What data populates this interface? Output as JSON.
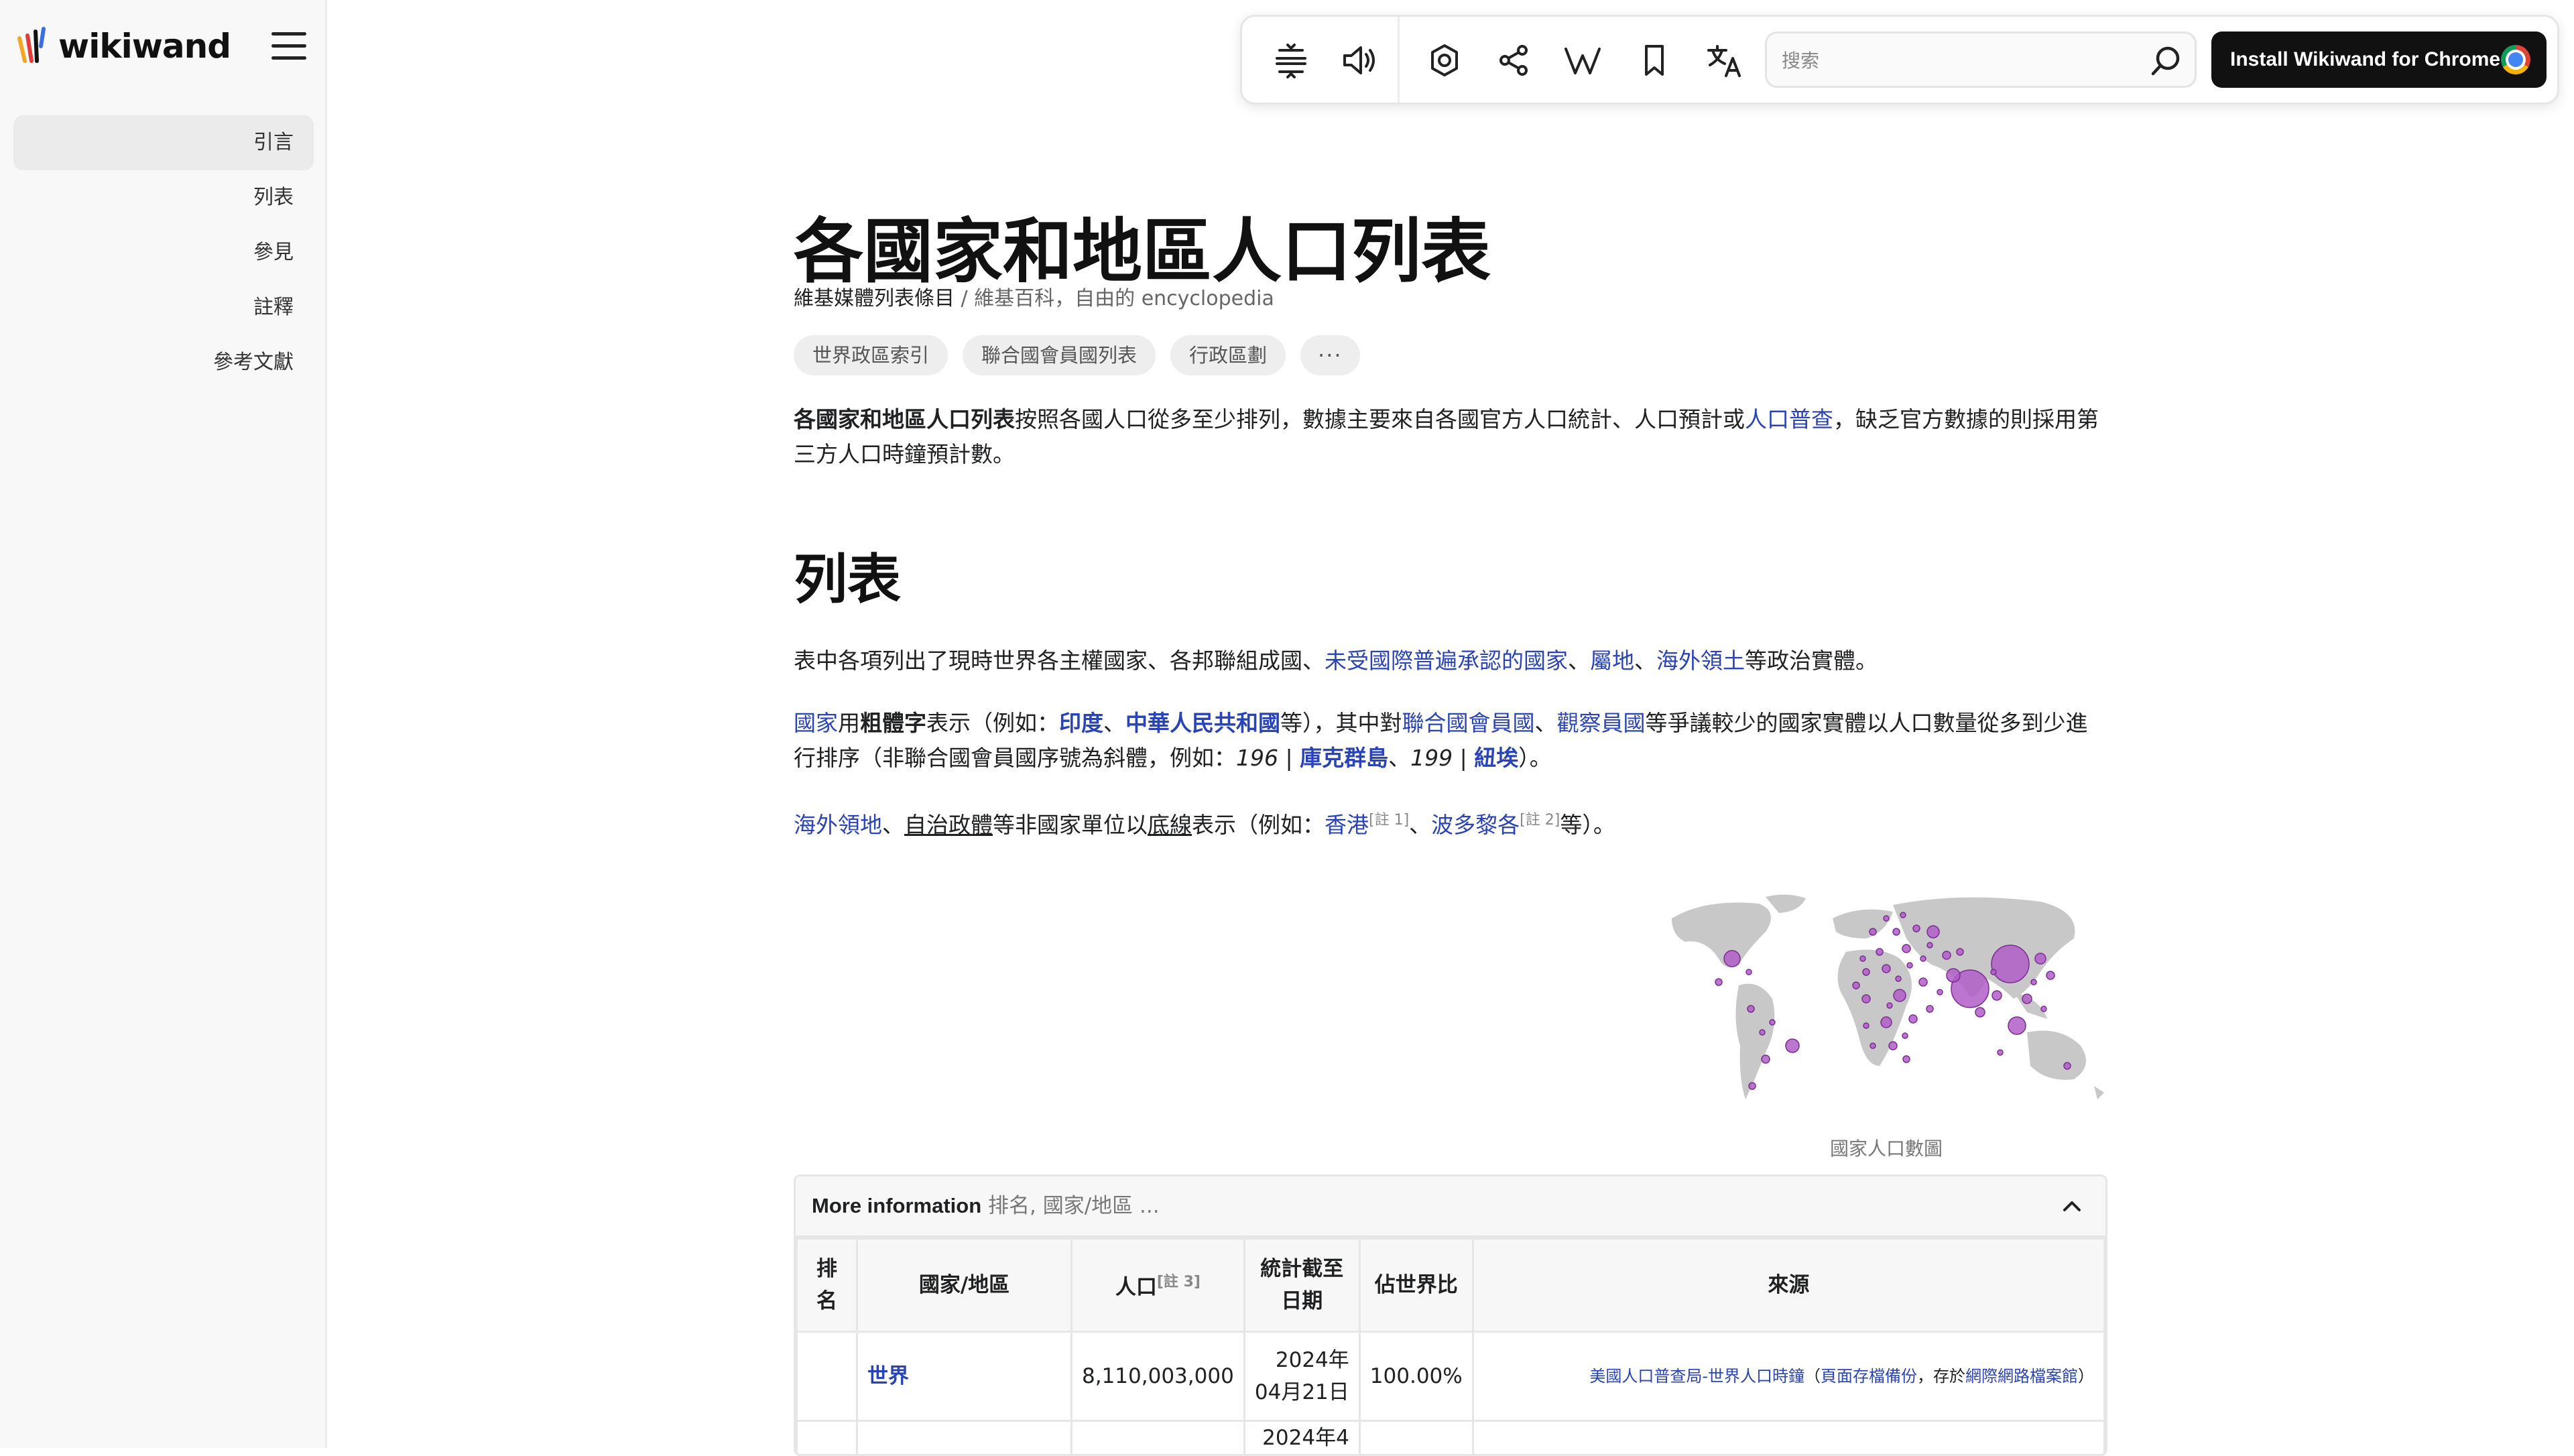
{
  "app": {
    "logo_text": "wikiwand"
  },
  "toc": {
    "items": [
      {
        "label": "引言"
      },
      {
        "label": "列表"
      },
      {
        "label": "參見"
      },
      {
        "label": "註釋"
      },
      {
        "label": "參考文獻"
      }
    ]
  },
  "toolbar": {
    "icons": [
      "text-density-icon",
      "speaker-icon",
      "settings-icon",
      "share-icon",
      "wikipedia-icon",
      "bookmark-icon",
      "translate-icon"
    ],
    "search_placeholder": "搜索",
    "install_label": "Install Wikiwand for Chrome"
  },
  "article": {
    "title": "各國家和地區人口列表",
    "subtitle_bold": "維基媒體列表條目",
    "subtitle_rest": " / 維基百科，自由的 encyclopedia",
    "chips": [
      "世界政區索引",
      "聯合國會員國列表",
      "行政區劃"
    ],
    "chips_more": "···",
    "intro": {
      "bold": "各國家和地區人口列表",
      "t1": "按照各國人口從多至少排列，數據主要來自各國官方人口統計、人口預計或",
      "link": "人口普查",
      "t2": "，缺乏官方數據的則採用第三方人口時鐘預計數。"
    },
    "section_title": "列表",
    "p1": {
      "t1": "表中各項列出了現時世界各主權國家、各邦聯組成國、",
      "l1": "未受國際普遍承認的國家",
      "s1": "、",
      "l2": "屬地",
      "s2": "、",
      "l3": "海外領土",
      "t2": "等政治實體。"
    },
    "p2": {
      "l1": "國家",
      "t1": "用",
      "b1": "粗體字",
      "t2": "表示（例如：",
      "l2": "印度",
      "s1": "、",
      "l3": "中華人民共和國",
      "t3": "等），其中對",
      "l4": "聯合國會員國",
      "s2": "、",
      "l5": "觀察員國",
      "t4": "等爭議較少的國家實體以人口數量從多到少進行排序（非聯合國會員國序號為斜體，例如：",
      "i1": "196",
      "bar1": " | ",
      "l6": "庫克群島",
      "s3": "、",
      "i2": "199",
      "bar2": " | ",
      "l7": "紐埃",
      "t5": "）。"
    },
    "p3": {
      "l1": "海外領地",
      "s1": "、",
      "u1": "自治政體",
      "t1": "等非國家單位以",
      "u2": "底線",
      "t2": "表示（例如：",
      "l2": "香港",
      "n1": "[註 1]",
      "s2": "、",
      "l3": "波多黎各",
      "n2": "[註 2]",
      "t3": "等）。"
    },
    "map_caption": "國家人口數圖"
  },
  "table": {
    "header_label": "More information",
    "header_cols": " 排名, 國家/地區 ...",
    "columns": {
      "rank": "排名",
      "country": "國家/地區",
      "population": "人口",
      "population_note": "[註 3]",
      "as_of": "統計截至日期",
      "share": "佔世界比",
      "source": "來源"
    },
    "rows": [
      {
        "rank": "",
        "country": "世界",
        "population": "8,110,003,000",
        "date_line1": "2024年",
        "date_line2": "04月21日",
        "share": "100.00%",
        "src_link1": "美國人口普查局-世界人口時鐘",
        "src_text1": "（",
        "src_link2": "頁面存檔備份",
        "src_text2": "，存於",
        "src_link3": "網際網路檔案館",
        "src_text3": "）"
      },
      {
        "rank": "",
        "country": "",
        "population": "",
        "date_line1": "2024年4",
        "date_line2": "",
        "share": "",
        "src_link1": "",
        "src_text1": "",
        "src_link2": "",
        "src_text2": "",
        "src_link3": "",
        "src_text3": ""
      }
    ]
  },
  "colors": {
    "link": "#2944b8",
    "bubble": "#b05ec8",
    "land": "#c8c8c8"
  }
}
